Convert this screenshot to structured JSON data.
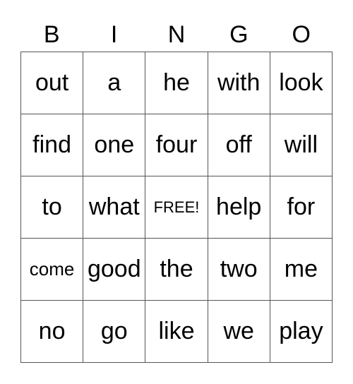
{
  "header": [
    "B",
    "I",
    "N",
    "G",
    "O"
  ],
  "grid": [
    [
      "out",
      "a",
      "he",
      "with",
      "look"
    ],
    [
      "find",
      "one",
      "four",
      "off",
      "will"
    ],
    [
      "to",
      "what",
      "FREE!",
      "help",
      "for"
    ],
    [
      "come",
      "good",
      "the",
      "two",
      "me"
    ],
    [
      "no",
      "go",
      "like",
      "we",
      "play"
    ]
  ]
}
